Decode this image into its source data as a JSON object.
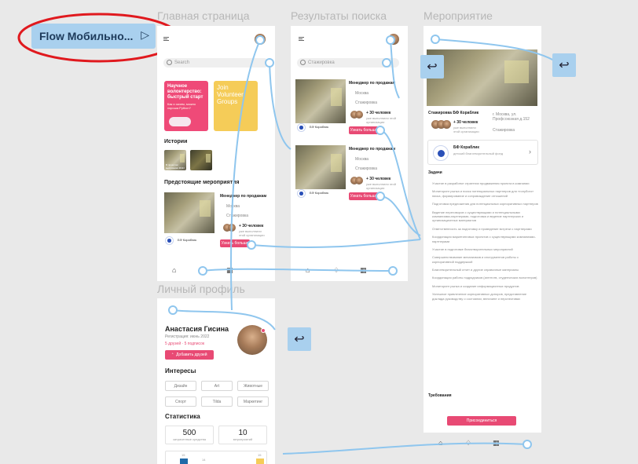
{
  "flow_button": {
    "label": "Flow Мобильно..."
  },
  "frames": {
    "home": {
      "title": "Главная страница",
      "search_placeholder": "Search",
      "promo1": {
        "title": "Научное волонтерство: быстрый старт",
        "sub": "Как и зачем, можно хороша Python?"
      },
      "promo2": {
        "title": "Join Volunteer Groups"
      },
      "stories_heading": "Истории",
      "story1": "В прошлом выпускники МЭИ",
      "upcoming_heading": "Предстоящие мероприятия",
      "event": {
        "title": "Менеджер по продажам",
        "city": "Москва",
        "type": "Стажировка",
        "people": "+ 30 человек",
        "people_sub": "уже выполнили этой организации",
        "org": "БФ Кораблик",
        "more": "Узнать больше"
      }
    },
    "search": {
      "title": "Результаты поиска",
      "search_value": "Стажировка",
      "cards": [
        {
          "title": "Менеджер по продажам",
          "city": "Москва",
          "type": "Стажировка",
          "people": "+ 30 человек",
          "people_sub": "уже выполнили этой организации",
          "org": "БФ Кораблик",
          "more": "Узнать больше"
        },
        {
          "title": "Менеджер по продажам",
          "city": "Москва",
          "type": "Стажировка",
          "people": "+ 30 человек",
          "people_sub": "уже выполнили этой организации",
          "org": "БФ Кораблик",
          "more": "Узнать больше"
        }
      ]
    },
    "event": {
      "title": "Мероприятие",
      "event_name": "Стажировка БФ Кораблик",
      "people": "+ 30 человек",
      "people_sub": "уже выполнили этой организации",
      "location": "г. Москва, ул. Профсоюзная д.152",
      "type": "Стажировка",
      "org_name": "БФ Кораблик",
      "org_sub": "детский благотворительный фонд",
      "tasks_heading": "Задачи",
      "tasks": [
        "Участие в разработке стратегии продвижения проекта в компании",
        "Мониторинг рынка и поиск потенциальных партнеров для «голубого» писка, формирование и сопровождение отношений",
        "Подготовка предложения для потенциальных корпоративных партнеров",
        "Ведение переговоров с существующими и потенциальными компаниями-партнерами, подготовка и ведение партнерских и организационных материалов",
        "Ответственность за подготовку и проведение встречи с партнерами",
        "Координация маркетинговых проектов с существующими компаниями-партнерами",
        "Участие в подготовке благотворительных мероприятий",
        "Совершенствование механизмов и инструментов работы с корпоративной поддержкой",
        "Благотворительный отчет и другие справочные материалы",
        "Координация работы подрядчиков (агентств, студенческих волонтеров)",
        "Мониторинг рынка и создание информационных продуктов",
        "Успешное привлечение корпоративных доноров, представление доклада руководству о состоянии, величине и перспективах"
      ],
      "requirements_heading": "Требования",
      "join_button": "Присоединиться"
    },
    "profile": {
      "title": "Личный профиль",
      "name": "Анастасия Гисина",
      "since": "Регистрация: июнь 2022",
      "stats_line": "5 друзей · 5 подписок",
      "add_friends": "Добавить друзей",
      "interests_heading": "Интересы",
      "interests": [
        "Дизайн",
        "Art",
        "Животные",
        "Спорт",
        "Tilda",
        "Маркетинг"
      ],
      "stats_heading": "Статистика",
      "stat1": {
        "value": "500",
        "label": "затраченные средства"
      },
      "stat2": {
        "value": "10",
        "label": "мероприятий"
      },
      "chart_labels": [
        "15",
        "14",
        "15"
      ]
    }
  },
  "nav": {
    "home_icon": "home-icon",
    "bell_icon": "bell-icon",
    "calendar_icon": "calendar-icon"
  },
  "colors": {
    "accent": "#e84a74",
    "flow_bg": "#a9d0ee",
    "highlight": "#e0191e",
    "connector": "#8fc6ee"
  }
}
